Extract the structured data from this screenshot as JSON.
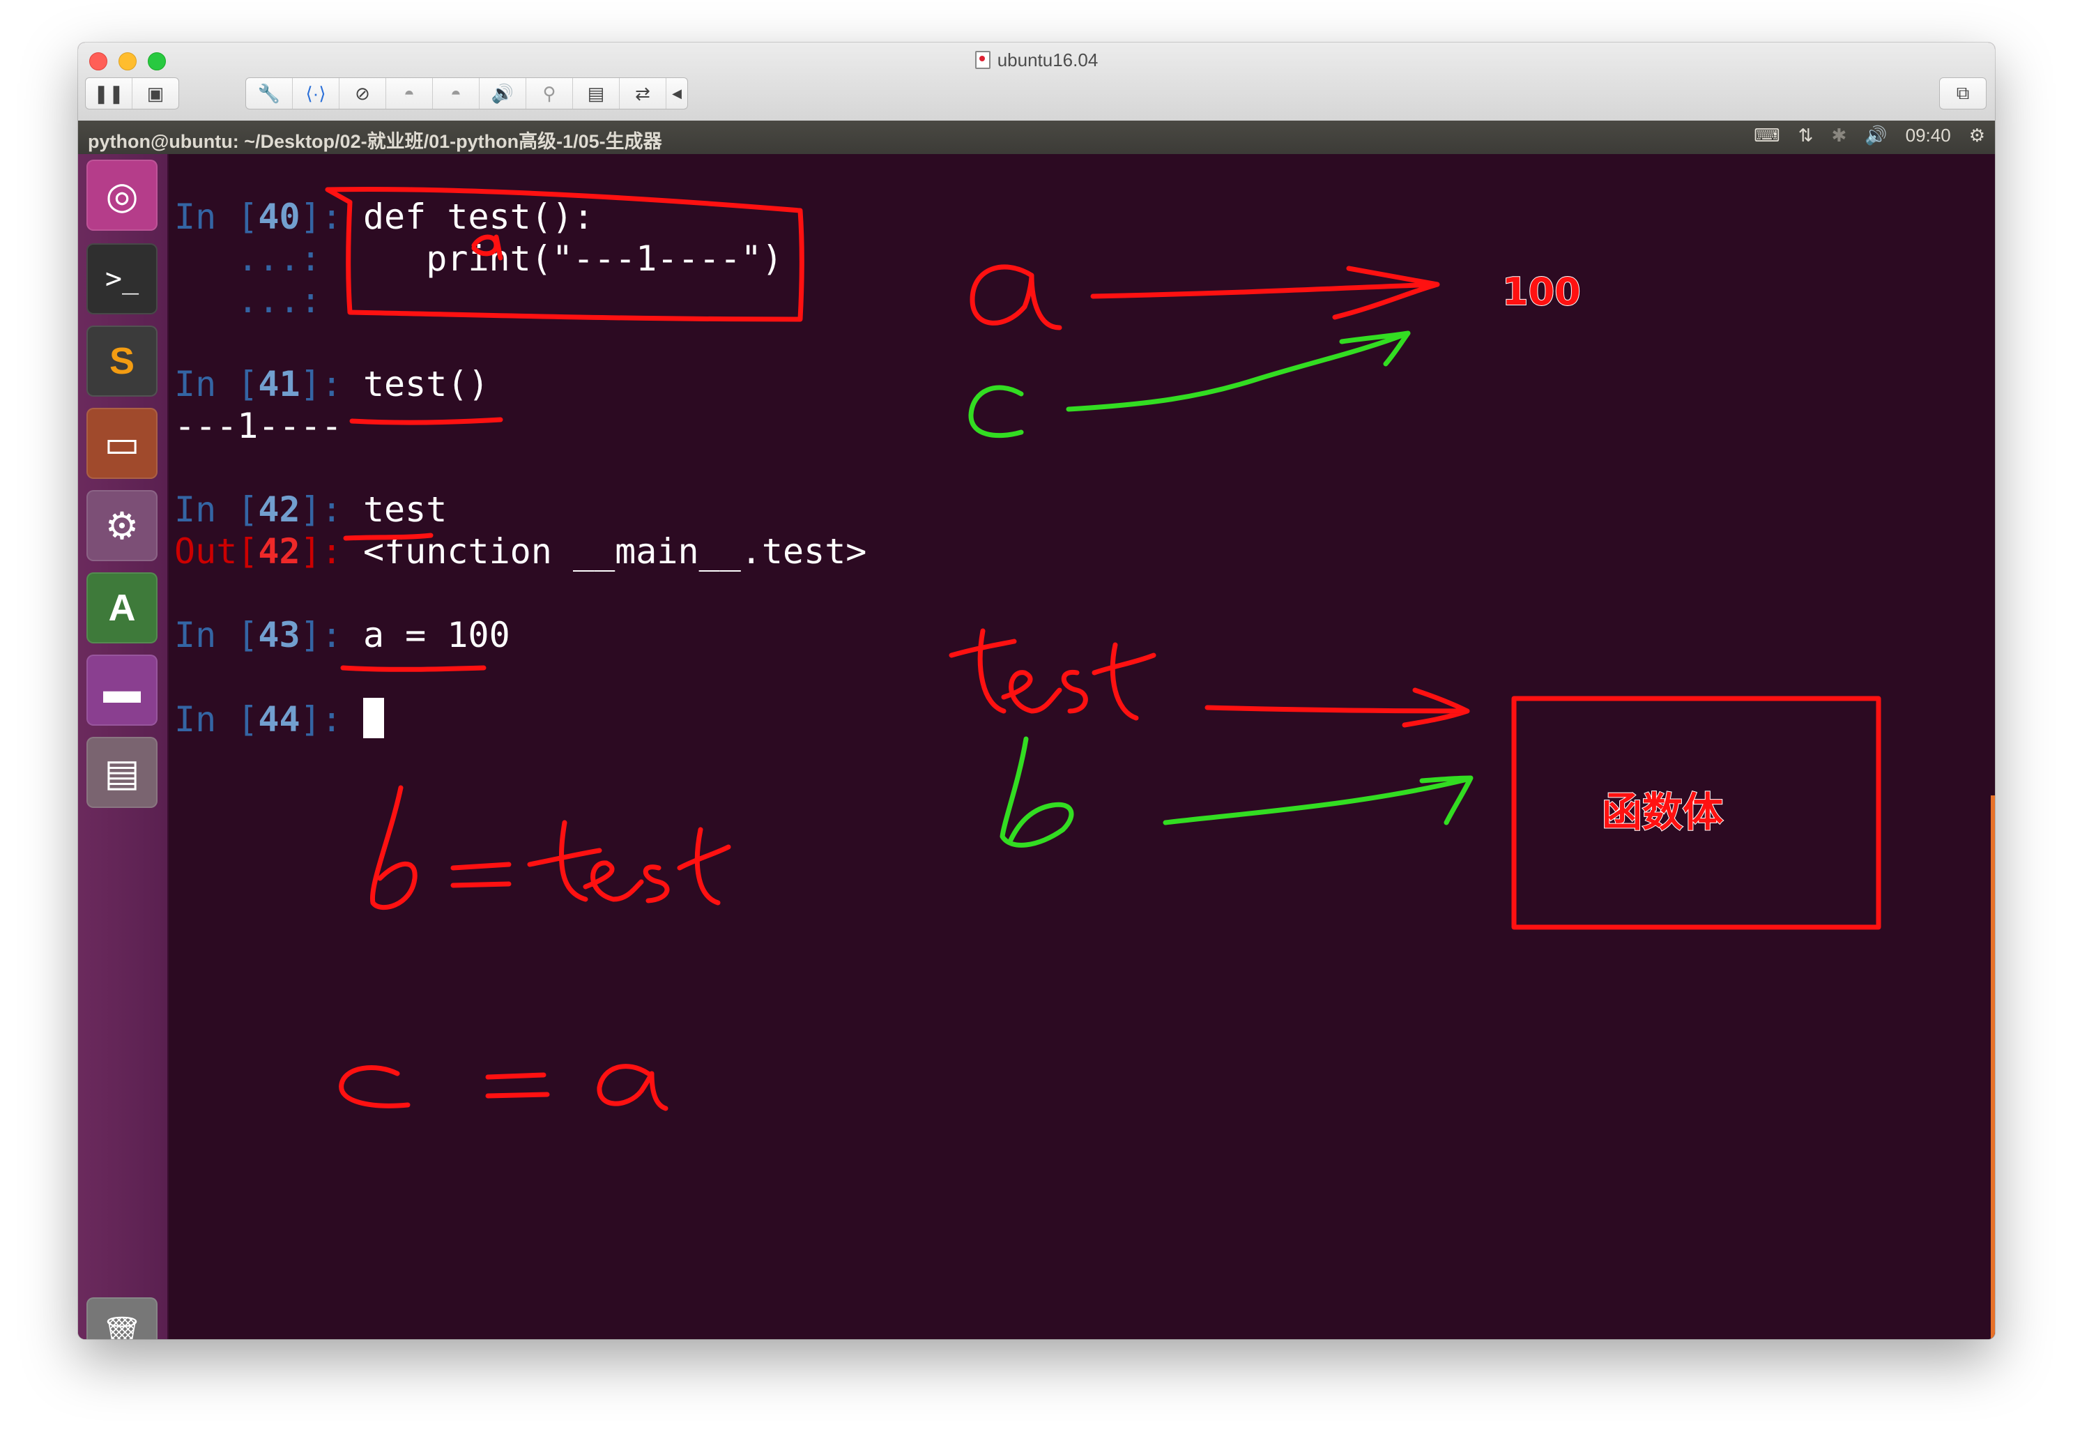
{
  "window": {
    "title": "ubuntu16.04",
    "toolbar_left": [
      {
        "name": "pause-icon",
        "glyph": "❚❚"
      },
      {
        "name": "snapshot-icon",
        "glyph": "▣"
      }
    ],
    "toolbar_right": [
      {
        "name": "settings-icon",
        "glyph": "🔧"
      },
      {
        "name": "network-icon",
        "glyph": "⟨·⟩"
      },
      {
        "name": "disk-icon",
        "glyph": "⊘"
      },
      {
        "name": "camera-icon",
        "glyph": "◓"
      },
      {
        "name": "camera2-icon",
        "glyph": "◓"
      },
      {
        "name": "sound-icon",
        "glyph": "🔊"
      },
      {
        "name": "usb-icon",
        "glyph": "⚲"
      },
      {
        "name": "floppy-icon",
        "glyph": "▤"
      },
      {
        "name": "share-icon",
        "glyph": "⇄"
      },
      {
        "name": "arrow-left-icon",
        "glyph": "◀"
      }
    ],
    "fullscreen_glyph": "⧉"
  },
  "ubuntu_panel": {
    "title": "python@ubuntu: ~/Desktop/02-就业班/01-python高级-1/05-生成器",
    "keyboard": "⌨",
    "network": "⇅",
    "bluetooth": "✱",
    "volume": "🔊",
    "time": "09:40",
    "power": "⚙"
  },
  "launcher": [
    {
      "name": "ubuntu-dash-icon",
      "glyph": "◎",
      "bg": "#b53d8a"
    },
    {
      "name": "terminal-icon",
      "glyph": ">_",
      "bg": "#2f2f2f"
    },
    {
      "name": "sublime-text-icon",
      "glyph": "S",
      "bg": "#3b3b3b"
    },
    {
      "name": "files-icon",
      "glyph": "▭",
      "bg": "#a04a2c"
    },
    {
      "name": "system-settings-icon",
      "glyph": "⚙",
      "bg": "#7c4f76"
    },
    {
      "name": "software-updater-icon",
      "glyph": "A",
      "bg": "#3e7a3a"
    },
    {
      "name": "workspace-switcher-icon",
      "glyph": "▬",
      "bg": "#8a3f90"
    },
    {
      "name": "save-drive-icon",
      "glyph": "▤",
      "bg": "#7a6470"
    },
    {
      "name": "trash-icon",
      "glyph": "🗑",
      "bg": "#777777"
    }
  ],
  "terminal": {
    "lines": [
      {
        "prompt": "In",
        "num": "40",
        "text": "def test():",
        "kind": "in"
      },
      {
        "prompt": "   ",
        "num": "",
        "cont": "...:",
        "text": "    print(\"---1----\")",
        "kind": "cont"
      },
      {
        "prompt": "   ",
        "num": "",
        "cont": "...:",
        "text": "",
        "kind": "cont"
      },
      {
        "prompt": "In",
        "num": "41",
        "text": "test()",
        "kind": "in"
      },
      {
        "text": "---1----",
        "kind": "out_plain"
      },
      {
        "prompt": "In",
        "num": "42",
        "text": "test",
        "kind": "in"
      },
      {
        "prompt": "Out",
        "num": "42",
        "text": "<function __main__.test>",
        "kind": "out"
      },
      {
        "prompt": "In",
        "num": "43",
        "text": "a = 100",
        "kind": "in"
      },
      {
        "prompt": "In",
        "num": "44",
        "text": "",
        "kind": "cursor"
      }
    ]
  },
  "annotations": {
    "value_label": "100",
    "function_box_label": "函数体",
    "handwritten": [
      "a",
      "c",
      "test",
      "b",
      "b=test",
      "c = a"
    ],
    "colors": {
      "red": "#ff1111",
      "green": "#33dd22"
    }
  }
}
